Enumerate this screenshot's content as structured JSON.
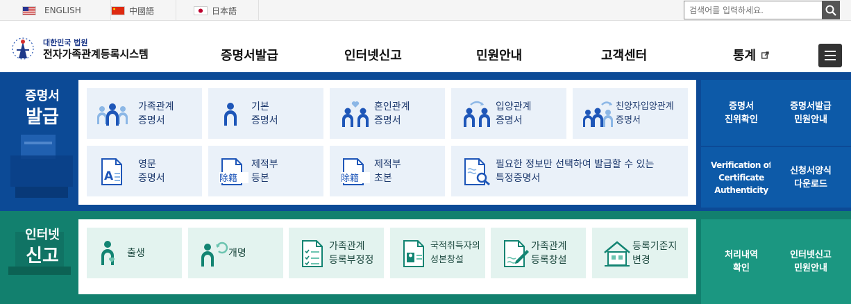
{
  "languages": [
    {
      "label": "ENGLISH",
      "flag": "us-flag-icon"
    },
    {
      "label": "中國語",
      "flag": "cn-flag-icon"
    },
    {
      "label": "日本語",
      "flag": "jp-flag-icon"
    }
  ],
  "search": {
    "placeholder": "검색어를 입력하세요.",
    "icon": "search-icon"
  },
  "logo": {
    "sub": "대한민국 법원",
    "main": "전자가족관계등록시스템"
  },
  "nav": [
    "증명서발급",
    "인터넷신고",
    "민원안내",
    "고객센터",
    "통계"
  ],
  "menu_icon": "hamburger-menu-icon",
  "certificate": {
    "title_line1": "증명서",
    "title_line2": "발급",
    "tiles": [
      {
        "label": "가족관계\n증명서",
        "icon": "family-icon"
      },
      {
        "label": "기본\n증명서",
        "icon": "person-icon"
      },
      {
        "label": "혼인관계\n증명서",
        "icon": "couple-heart-icon"
      },
      {
        "label": "입양관계\n증명서",
        "icon": "adoption-icon"
      },
      {
        "label": "친양자입양관계\n증명서",
        "icon": "full-adoption-icon"
      },
      {
        "label": "영문\n증명서",
        "icon": "english-document-icon"
      },
      {
        "label": "제적부\n등본",
        "icon": "removed-register-icon"
      },
      {
        "label": "제적부\n초본",
        "icon": "removed-register-icon"
      },
      {
        "label": "필요한 정보만 선택하여 발급할 수 있는\n특정증명서",
        "icon": "document-search-icon"
      }
    ],
    "side": [
      {
        "label": "증명서\n진위확인"
      },
      {
        "label": "증명서발급\n민원안내"
      },
      {
        "label": "Verification of\nCertificate\nAuthenticity"
      },
      {
        "label": "신청서양식\n다운로드"
      }
    ],
    "removed_glyph": "除籍",
    "english_glyph": "A"
  },
  "report": {
    "title_line1": "인터넷",
    "title_line2": "신고",
    "tiles": [
      {
        "label": "출생",
        "icon": "birth-icon"
      },
      {
        "label": "개명",
        "icon": "rename-icon"
      },
      {
        "label": "가족관계\n등록부정정",
        "icon": "checklist-icon"
      },
      {
        "label": "국적취득자의\n성본창설",
        "icon": "id-card-icon"
      },
      {
        "label": "가족관계\n등록창설",
        "icon": "document-pen-icon"
      },
      {
        "label": "등록기준지\n변경",
        "icon": "house-icon"
      }
    ],
    "side": [
      {
        "label": "처리내역\n확인"
      },
      {
        "label": "인터넷신고\n민원안내"
      }
    ]
  }
}
